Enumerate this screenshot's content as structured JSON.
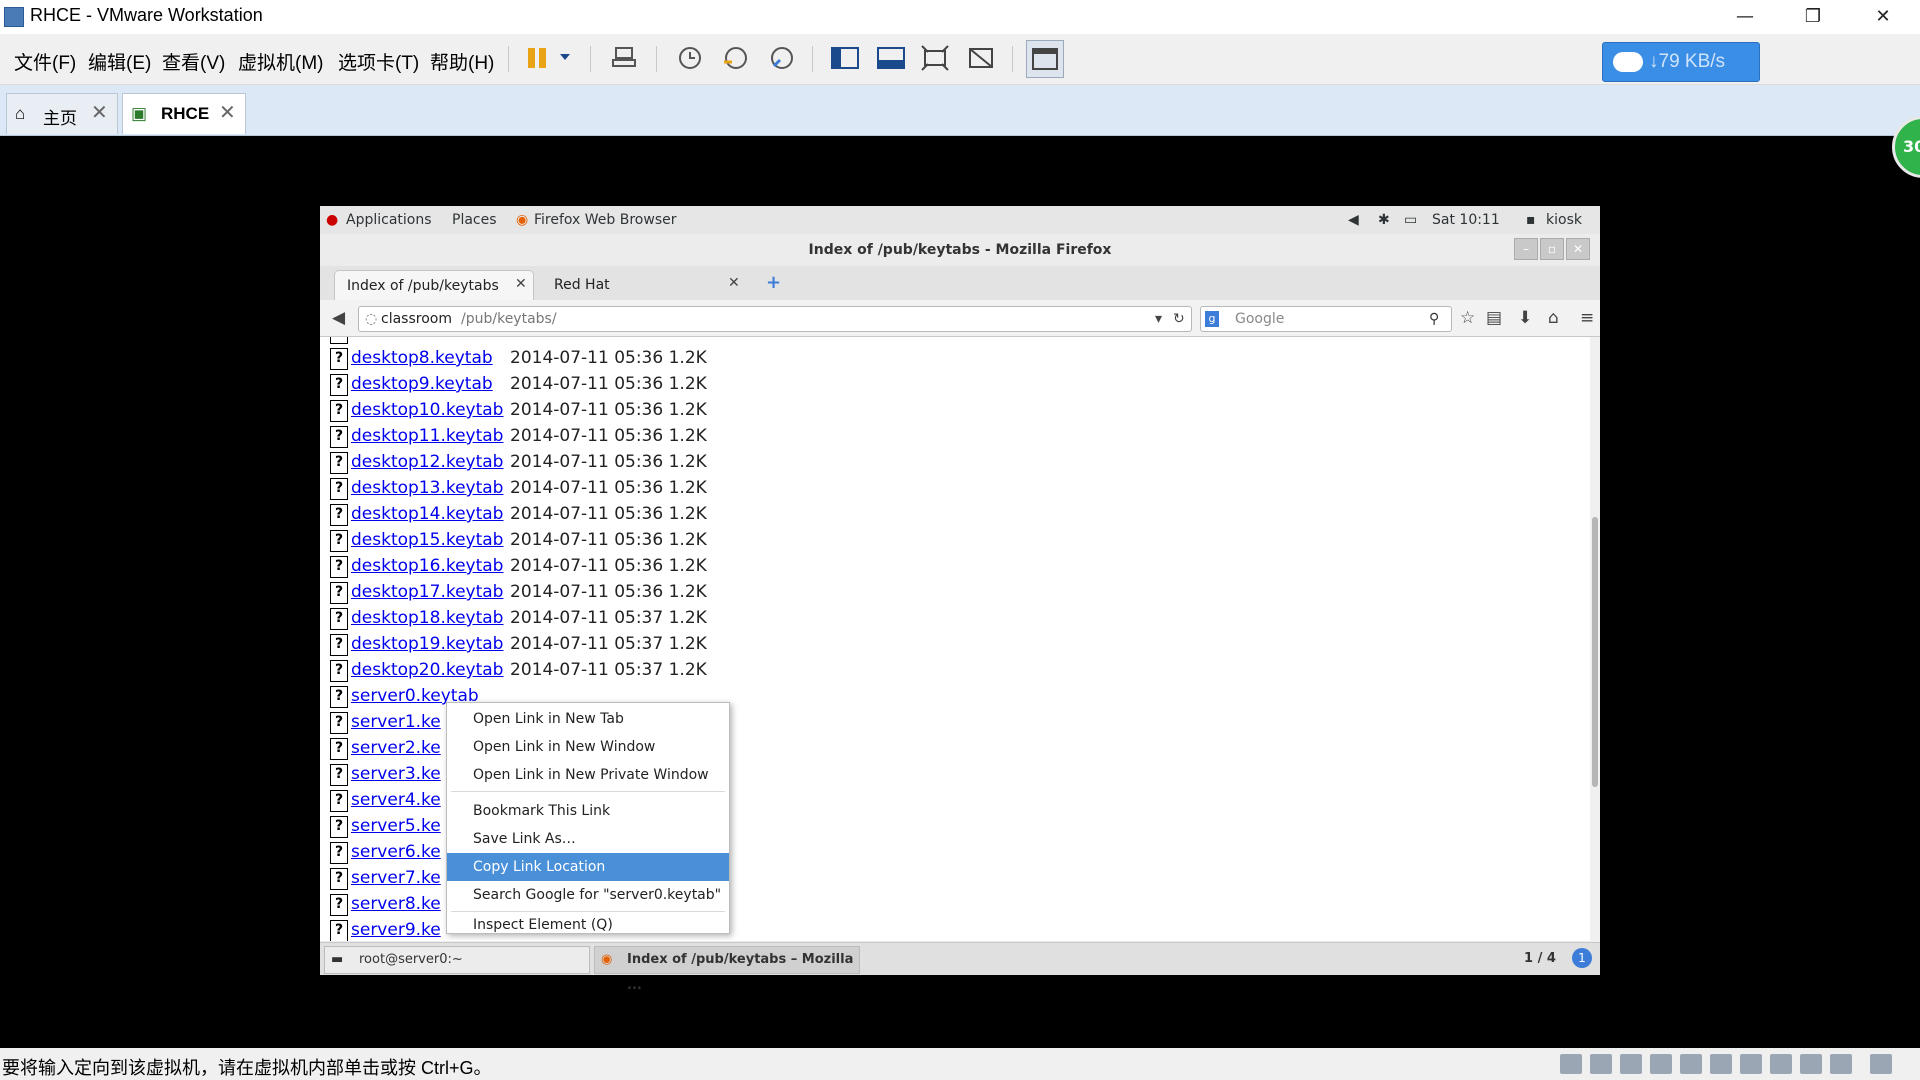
{
  "window": {
    "title": "RHCE - VMware Workstation",
    "minimize": "—",
    "restore": "❐",
    "close": "✕"
  },
  "menus": [
    "文件(F)",
    "编辑(E)",
    "查看(V)",
    "虚拟机(M)",
    "选项卡(T)",
    "帮助(H)"
  ],
  "network": {
    "speed": "79 KB/s",
    "arrow": "↓"
  },
  "vm_tabs": [
    {
      "label": "主页",
      "close": "✕"
    },
    {
      "label": "RHCE",
      "close": "✕"
    }
  ],
  "badge": "30",
  "status_message": "要将输入定向到该虚拟机，请在虚拟机内部单击或按 Ctrl+G。",
  "guest": {
    "topbar": {
      "applications": "Applications",
      "places": "Places",
      "app_name": "Firefox Web Browser",
      "time": "Sat 10:11",
      "user": "kiosk"
    },
    "firefox_title": "Index of /pub/keytabs - Mozilla Firefox",
    "tabs": [
      {
        "label": "Index of /pub/keytabs",
        "close": "✕"
      },
      {
        "label": "Red Hat",
        "close": "✕"
      }
    ],
    "new_tab": "+",
    "url": {
      "host": "classroom",
      "path": "/pub/keytabs/"
    },
    "search_placeholder": "Google",
    "files": [
      {
        "name": "desktop8.keytab",
        "date": "2014-07-11 05:36",
        "size": "1.2K"
      },
      {
        "name": "desktop9.keytab",
        "date": "2014-07-11 05:36",
        "size": "1.2K"
      },
      {
        "name": "desktop10.keytab",
        "date": "2014-07-11 05:36",
        "size": "1.2K"
      },
      {
        "name": "desktop11.keytab",
        "date": "2014-07-11 05:36",
        "size": "1.2K"
      },
      {
        "name": "desktop12.keytab",
        "date": "2014-07-11 05:36",
        "size": "1.2K"
      },
      {
        "name": "desktop13.keytab",
        "date": "2014-07-11 05:36",
        "size": "1.2K"
      },
      {
        "name": "desktop14.keytab",
        "date": "2014-07-11 05:36",
        "size": "1.2K"
      },
      {
        "name": "desktop15.keytab",
        "date": "2014-07-11 05:36",
        "size": "1.2K"
      },
      {
        "name": "desktop16.keytab",
        "date": "2014-07-11 05:36",
        "size": "1.2K"
      },
      {
        "name": "desktop17.keytab",
        "date": "2014-07-11 05:36",
        "size": "1.2K"
      },
      {
        "name": "desktop18.keytab",
        "date": "2014-07-11 05:37",
        "size": "1.2K"
      },
      {
        "name": "desktop19.keytab",
        "date": "2014-07-11 05:37",
        "size": "1.2K"
      },
      {
        "name": "desktop20.keytab",
        "date": "2014-07-11 05:37",
        "size": "1.2K"
      },
      {
        "name": "server0.keytab",
        "date": "",
        "size": ""
      },
      {
        "name": "server1.ke",
        "date": "",
        "size": ""
      },
      {
        "name": "server2.ke",
        "date": "",
        "size": ""
      },
      {
        "name": "server3.ke",
        "date": "",
        "size": ""
      },
      {
        "name": "server4.ke",
        "date": "",
        "size": ""
      },
      {
        "name": "server5.ke",
        "date": "",
        "size": ""
      },
      {
        "name": "server6.ke",
        "date": "",
        "size": ""
      },
      {
        "name": "server7.ke",
        "date": "",
        "size": ""
      },
      {
        "name": "server8.ke",
        "date": "",
        "size": ""
      },
      {
        "name": "server9.ke",
        "date": "",
        "size": ""
      }
    ],
    "context_menu": [
      {
        "label": "Open Link in New Tab"
      },
      {
        "label": "Open Link in New Window"
      },
      {
        "label": "Open Link in New Private Window"
      },
      {
        "label": "Bookmark This Link"
      },
      {
        "label": "Save Link As…"
      },
      {
        "label": "Copy Link Location",
        "highlighted": true
      },
      {
        "label": "Search Google for \"server0.keytab\""
      },
      {
        "label": "Inspect Element (Q)"
      }
    ],
    "taskbar": {
      "terminal": "root@server0:~",
      "firefox": "Index of /pub/keytabs – Mozilla ...",
      "workspace": "1 / 4"
    }
  }
}
